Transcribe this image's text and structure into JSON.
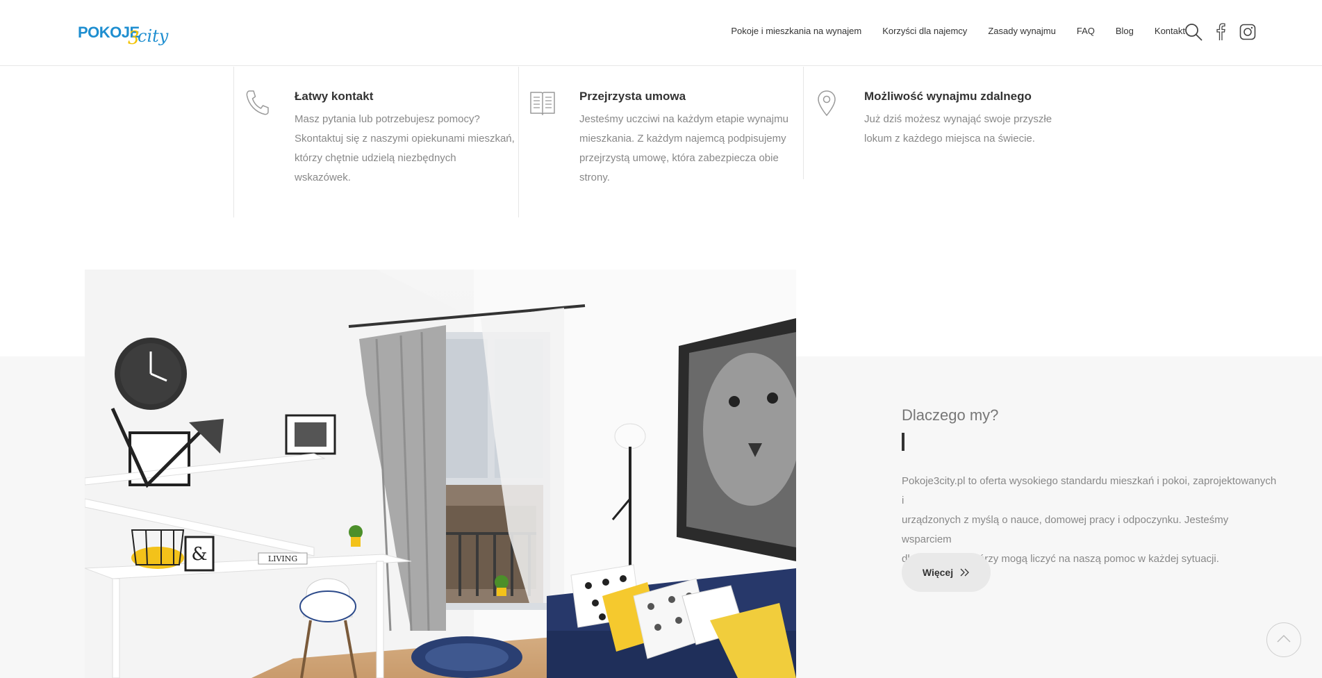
{
  "header": {
    "logo_text_main": "POKOJE",
    "logo_text_num": "3",
    "logo_text_city": "city",
    "nav": [
      "Pokoje i mieszkania na wynajem",
      "Korzyści dla najemcy",
      "Zasady wynajmu",
      "FAQ",
      "Blog",
      "Kontakt"
    ],
    "icons": [
      "search-icon",
      "facebook-icon",
      "instagram-icon"
    ]
  },
  "features": [
    {
      "icon": "phone-icon",
      "title": "Łatwy kontakt",
      "lines": [
        "Masz pytania lub potrzebujesz pomocy?",
        "Skontaktuj się z naszymi opiekunami mieszkań,",
        "którzy chętnie udzielą niezbędnych",
        "wskazówek."
      ]
    },
    {
      "icon": "book-icon",
      "title": "Przejrzysta umowa",
      "lines": [
        "Jesteśmy uczciwi na każdym etapie wynajmu",
        "mieszkania. Z każdym najemcą podpisujemy",
        "przejrzystą umowę, która zabezpiecza obie",
        "strony."
      ]
    },
    {
      "icon": "location-pin-icon",
      "title": "Możliwość wynajmu zdalnego",
      "lines": [
        "Już dziś możesz wynająć swoje przyszłe",
        "lokum z każdego miejsca na świecie."
      ]
    }
  ],
  "why": {
    "title": "Dlaczego my?",
    "lines": [
      "Pokoje3city.pl to oferta wysokiego standardu mieszkań i pokoi, zaprojektowanych i",
      "urządzonych z myślą o nauce, domowej pracy i odpoczynku. Jesteśmy wsparciem",
      "dla najemców, którzy mogą liczyć na naszą pomoc w każdej sytuacji."
    ],
    "button": "Więcej"
  },
  "photo_alt": "room-interior-photo",
  "photo_sign_text": "LIVING",
  "colors": {
    "brand_blue": "#1e8ed0",
    "brand_yellow": "#f2c200",
    "gray_bg": "#f7f7f7"
  }
}
